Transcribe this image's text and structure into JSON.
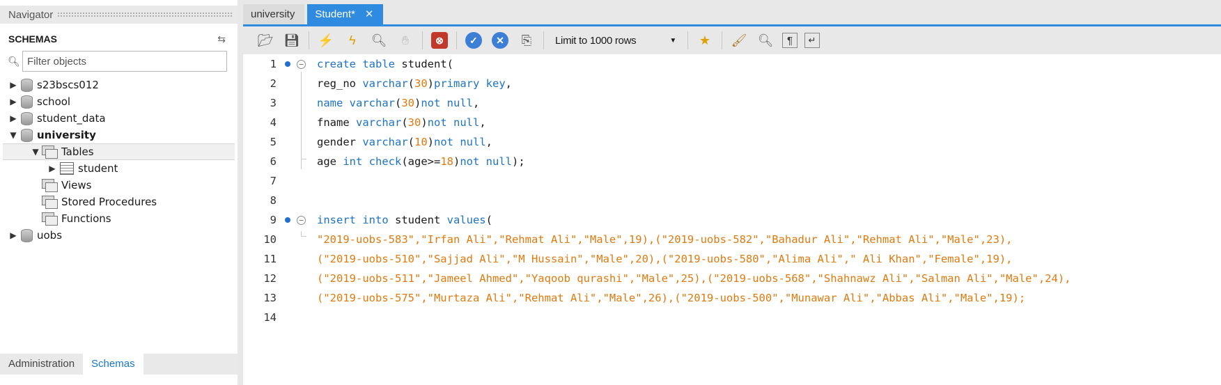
{
  "navigator": {
    "title": "Navigator",
    "schemas_label": "SCHEMAS",
    "filter_placeholder": "Filter objects",
    "tree": [
      {
        "label": "s23bscs012",
        "expanded": false
      },
      {
        "label": "school",
        "expanded": false
      },
      {
        "label": "student_data",
        "expanded": false
      },
      {
        "label": "university",
        "expanded": true
      },
      {
        "label": "Tables",
        "expanded": true
      },
      {
        "label": "student",
        "expanded": false
      },
      {
        "label": "Views"
      },
      {
        "label": "Stored Procedures"
      },
      {
        "label": "Functions"
      },
      {
        "label": "uobs",
        "expanded": false
      }
    ],
    "bottom_tabs": [
      "Administration",
      "Schemas"
    ],
    "active_bottom_tab": "Schemas"
  },
  "editor_tabs": [
    {
      "label": "university",
      "active": false
    },
    {
      "label": "Student*",
      "active": true
    }
  ],
  "toolbar": {
    "icons": [
      "open-file-icon",
      "save-icon",
      "execute-icon",
      "execute-current-icon",
      "explain-icon",
      "stop-icon",
      "toggle-error-icon",
      "commit-icon",
      "rollback-icon",
      "autocommit-icon",
      "beautify-icon",
      "find-icon",
      "invisible-chars-icon",
      "word-wrap-icon",
      "add-snippet-icon"
    ],
    "limit_label": "Limit to 1000 rows"
  },
  "colors": {
    "accent": "#2f8be0",
    "keyword": "#1d73c7",
    "literal": "#e07a0e"
  },
  "code_lines": [
    {
      "n": "1",
      "text": "create table student("
    },
    {
      "n": "2",
      "text": "reg_no varchar(30)primary key,"
    },
    {
      "n": "3",
      "text": "name varchar(30)not null,"
    },
    {
      "n": "4",
      "text": "fname varchar(30)not null,"
    },
    {
      "n": "5",
      "text": "gender varchar(10)not null,"
    },
    {
      "n": "6",
      "text": "age int check(age>=18)not null);"
    },
    {
      "n": "7",
      "text": ""
    },
    {
      "n": "8",
      "text": ""
    },
    {
      "n": "9",
      "text": "insert into student values("
    },
    {
      "n": "10",
      "text": "\"2019-uobs-583\",\"Irfan Ali\",\"Rehmat Ali\",\"Male\",19),(\"2019-uobs-582\",\"Bahadur Ali\",\"Rehmat Ali\",\"Male\",23),"
    },
    {
      "n": "11",
      "text": "(\"2019-uobs-510\",\"Sajjad Ali\",\"M Hussain\",\"Male\",20),(\"2019-uobs-580\",\"Alima Ali\",\" Ali Khan\",\"Female\",19),"
    },
    {
      "n": "12",
      "text": "(\"2019-uobs-511\",\"Jameel Ahmed\",\"Yaqoob qurashi\",\"Male\",25),(\"2019-uobs-568\",\"Shahnawz Ali\",\"Salman Ali\",\"Male\",24),"
    },
    {
      "n": "13",
      "text": "(\"2019-uobs-575\",\"Murtaza Ali\",\"Rehmat Ali\",\"Male\",26),(\"2019-uobs-500\",\"Munawar Ali\",\"Abbas Ali\",\"Male\",19);"
    },
    {
      "n": "14",
      "text": ""
    }
  ]
}
